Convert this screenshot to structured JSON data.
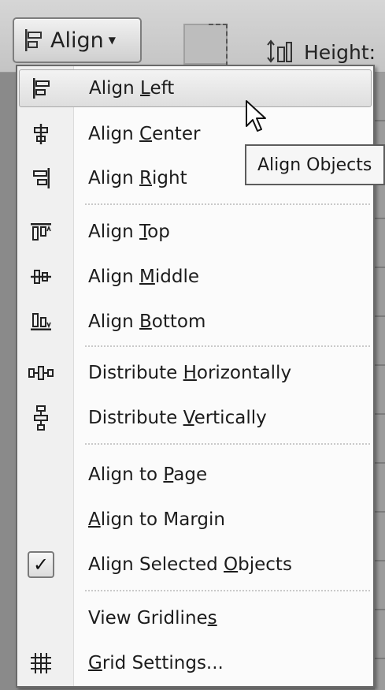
{
  "ribbon": {
    "align_label": "Align",
    "height_label": "Height:"
  },
  "menu": {
    "items": [
      {
        "id": "align-left",
        "icon": "align-left-icon",
        "pre": "Align ",
        "key": "L",
        "post": "eft",
        "hover": true
      },
      {
        "id": "align-center",
        "icon": "align-center-icon",
        "pre": "Align ",
        "key": "C",
        "post": "enter"
      },
      {
        "id": "align-right",
        "icon": "align-right-icon",
        "pre": "Align ",
        "key": "R",
        "post": "ight"
      },
      {
        "id": "align-top",
        "icon": "align-top-icon",
        "pre": "Align ",
        "key": "T",
        "post": "op"
      },
      {
        "id": "align-middle",
        "icon": "align-middle-icon",
        "pre": "Align ",
        "key": "M",
        "post": "iddle"
      },
      {
        "id": "align-bottom",
        "icon": "align-bottom-icon",
        "pre": "Align ",
        "key": "B",
        "post": "ottom"
      },
      {
        "id": "distribute-horizontally",
        "icon": "distribute-horizontally-icon",
        "pre": "Distribute ",
        "key": "H",
        "post": "orizontally"
      },
      {
        "id": "distribute-vertically",
        "icon": "distribute-vertically-icon",
        "pre": "Distribute ",
        "key": "V",
        "post": "ertically"
      },
      {
        "id": "align-to-page",
        "icon": "",
        "pre": "Align to ",
        "key": "P",
        "post": "age"
      },
      {
        "id": "align-to-margin",
        "icon": "",
        "pre": "",
        "key": "A",
        "post": "lign to Margin"
      },
      {
        "id": "align-selected-objects",
        "icon": "checkmark-icon",
        "pre": "Align Selected ",
        "key": "O",
        "post": "bjects",
        "checked": true
      },
      {
        "id": "view-gridlines",
        "icon": "",
        "pre": "View Gridline",
        "key": "s",
        "post": ""
      },
      {
        "id": "grid-settings",
        "icon": "grid-icon",
        "pre": "",
        "key": "G",
        "post": "rid Settings..."
      }
    ],
    "check_glyph": "✓"
  },
  "tooltip": {
    "text": "Align Objects"
  },
  "colors": {
    "menu_bg": "#fbfbfb",
    "hover_bg": "#e4e4e4",
    "gutter_bg": "#f0f0f0"
  }
}
